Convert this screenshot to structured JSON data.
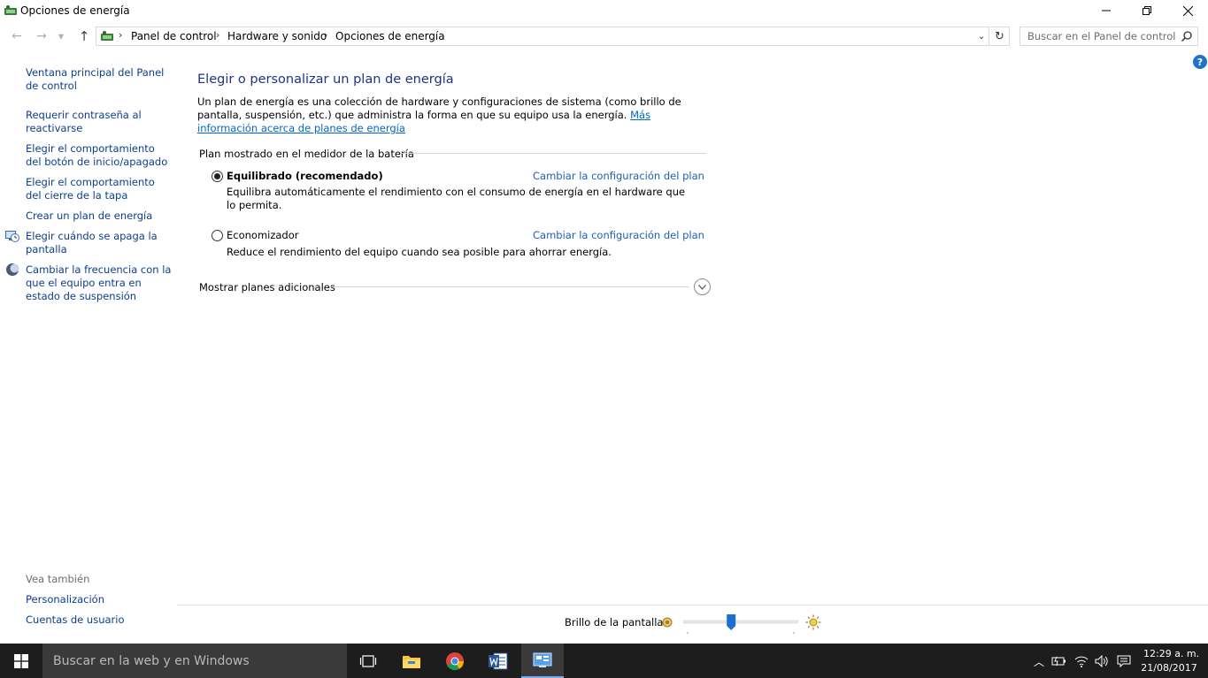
{
  "window": {
    "title": "Opciones de energía"
  },
  "address": {
    "crumbs": [
      "Panel de control",
      "Hardware y sonido",
      "Opciones de energía"
    ]
  },
  "search": {
    "placeholder": "Buscar en el Panel de control"
  },
  "sidebar": {
    "tasks": [
      "Ventana principal del Panel de control",
      "Requerir contraseña al reactivarse",
      "Elegir el comportamiento del botón de inicio/apagado",
      "Elegir el comportamiento del cierre de la tapa",
      "Crear un plan de energía",
      "Elegir cuándo se apaga la pantalla",
      "Cambiar la frecuencia con la que el equipo entra en estado de suspensión"
    ],
    "see_also_heading": "Vea también",
    "see_also": [
      "Personalización",
      "Cuentas de usuario"
    ]
  },
  "main": {
    "title": "Elegir o personalizar un plan de energía",
    "intro_text": "Un plan de energía es una colección de hardware y configuraciones de sistema (como brillo de pantalla, suspensión, etc.) que administra la forma en que su equipo usa la energía. ",
    "intro_link": "Más información acerca de planes de energía",
    "battery_group_label": "Plan mostrado en el medidor de la batería",
    "plans": [
      {
        "name": "Equilibrado (recomendado)",
        "description": "Equilibra automáticamente el rendimiento con el consumo de energía en el hardware que lo permita.",
        "link": "Cambiar la configuración del plan",
        "selected": true
      },
      {
        "name": "Economizador",
        "description": "Reduce el rendimiento del equipo cuando sea posible para ahorrar energía.",
        "link": "Cambiar la configuración del plan",
        "selected": false
      }
    ],
    "more_plans_label": "Mostrar planes adicionales"
  },
  "brightness": {
    "label": "Brillo de la pantalla:",
    "level": 0.41
  },
  "taskbar": {
    "search_text": "Buscar en la web y en Windows",
    "time": "12:29 a. m.",
    "date": "21/08/2017"
  },
  "colors": {
    "link": "#1e5fb4",
    "title": "#1e3287",
    "taskbar": "#1d1d1d",
    "accent": "#1e73c8"
  }
}
